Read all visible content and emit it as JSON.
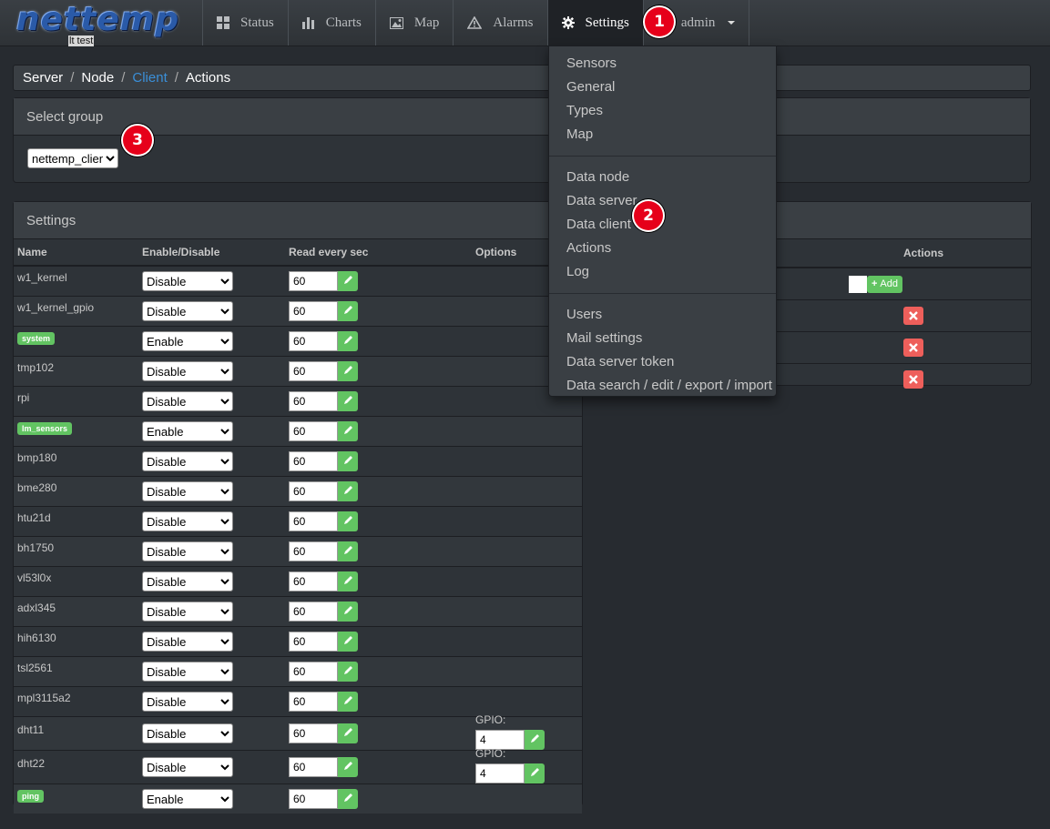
{
  "brand": {
    "logo": "nettemp",
    "subtitle": "lt test"
  },
  "nav": {
    "items": [
      {
        "label": "Status",
        "icon": "grid-icon"
      },
      {
        "label": "Charts",
        "icon": "bar-chart-icon"
      },
      {
        "label": "Map",
        "icon": "picture-icon"
      },
      {
        "label": "Alarms",
        "icon": "warning-icon"
      },
      {
        "label": "Settings",
        "icon": "gear-icon"
      },
      {
        "label": "admin",
        "icon": "user-icon"
      }
    ]
  },
  "badges": {
    "b1": "1",
    "b2": "2",
    "b3": "3"
  },
  "breadcrumb": {
    "server": "Server",
    "node": "Node",
    "client": "Client",
    "actions": "Actions",
    "sep": "/"
  },
  "group_panel": {
    "title": "Select group",
    "selected": "nettemp_client"
  },
  "settings_panel": {
    "title": "Settings",
    "columns": {
      "name": "Name",
      "enable": "Enable/Disable",
      "read": "Read every sec",
      "options": "Options"
    },
    "gpio_label": "GPIO:"
  },
  "rows": [
    {
      "name": "w1_kernel",
      "state": "Disable",
      "sec": "60",
      "tag": false
    },
    {
      "name": "w1_kernel_gpio",
      "state": "Disable",
      "sec": "60",
      "tag": false
    },
    {
      "name": "system",
      "state": "Enable",
      "sec": "60",
      "tag": true
    },
    {
      "name": "tmp102",
      "state": "Disable",
      "sec": "60",
      "tag": false
    },
    {
      "name": "rpi",
      "state": "Disable",
      "sec": "60",
      "tag": false
    },
    {
      "name": "lm_sensors",
      "state": "Enable",
      "sec": "60",
      "tag": true
    },
    {
      "name": "bmp180",
      "state": "Disable",
      "sec": "60",
      "tag": false
    },
    {
      "name": "bme280",
      "state": "Disable",
      "sec": "60",
      "tag": false
    },
    {
      "name": "htu21d",
      "state": "Disable",
      "sec": "60",
      "tag": false
    },
    {
      "name": "bh1750",
      "state": "Disable",
      "sec": "60",
      "tag": false
    },
    {
      "name": "vl53l0x",
      "state": "Disable",
      "sec": "60",
      "tag": false
    },
    {
      "name": "adxl345",
      "state": "Disable",
      "sec": "60",
      "tag": false
    },
    {
      "name": "hih6130",
      "state": "Disable",
      "sec": "60",
      "tag": false
    },
    {
      "name": "tsl2561",
      "state": "Disable",
      "sec": "60",
      "tag": false
    },
    {
      "name": "mpl3115a2",
      "state": "Disable",
      "sec": "60",
      "tag": false
    },
    {
      "name": "dht11",
      "state": "Disable",
      "sec": "60",
      "tag": false,
      "gpio": "4"
    },
    {
      "name": "dht22",
      "state": "Disable",
      "sec": "60",
      "tag": false,
      "gpio": "4"
    },
    {
      "name": "ping",
      "state": "Enable",
      "sec": "60",
      "tag": true
    }
  ],
  "right_panel": {
    "actions_header": "Actions",
    "add_label": "Add"
  },
  "dropdown": {
    "groups": [
      [
        "Sensors",
        "General",
        "Types",
        "Map"
      ],
      [
        "Data node",
        "Data server",
        "Data client",
        "Actions",
        "Log"
      ],
      [
        "Users",
        "Mail settings",
        "Data server token",
        "Data search / edit / export / import"
      ]
    ]
  },
  "colors": {
    "accent_green": "#62c462",
    "danger_red": "#ee5f5b",
    "link_blue": "#3a8fd8",
    "badge_red": "#e6001a"
  }
}
